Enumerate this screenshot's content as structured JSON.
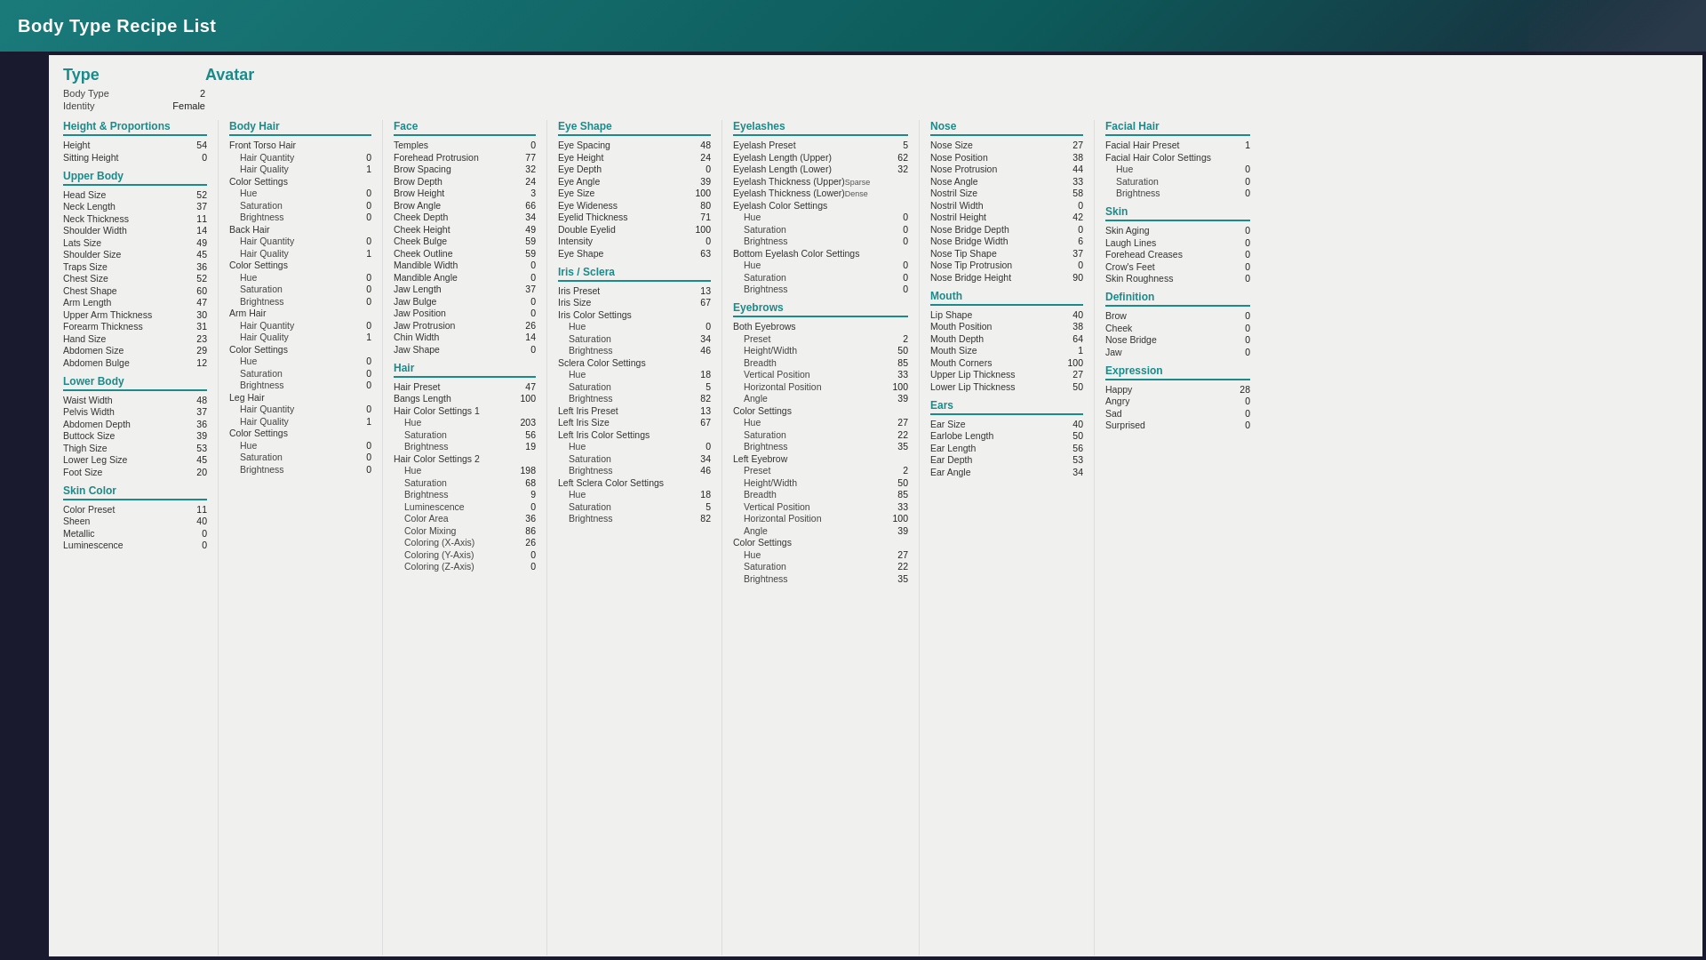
{
  "title": "Body Type Recipe List",
  "type": {
    "header": "Type",
    "rows": [
      {
        "name": "Body Type",
        "value": "2"
      },
      {
        "name": "Identity",
        "value": "Female"
      }
    ]
  },
  "avatar": {
    "header": "Avatar",
    "heightProportions": {
      "header": "Height & Proportions",
      "rows": [
        {
          "name": "Height",
          "value": "54"
        },
        {
          "name": "Sitting Height",
          "value": "0"
        }
      ]
    },
    "upperBody": {
      "header": "Upper Body",
      "rows": [
        {
          "name": "Head Size",
          "value": "52"
        },
        {
          "name": "Neck Length",
          "value": "37"
        },
        {
          "name": "Neck Thickness",
          "value": "11"
        },
        {
          "name": "Shoulder Width",
          "value": "14"
        },
        {
          "name": "Lats Size",
          "value": "49"
        },
        {
          "name": "Shoulder Size",
          "value": "45"
        },
        {
          "name": "Traps Size",
          "value": "36"
        },
        {
          "name": "Chest Size",
          "value": "52"
        },
        {
          "name": "Chest Shape",
          "value": "60"
        },
        {
          "name": "Arm Length",
          "value": "47"
        },
        {
          "name": "Upper Arm Thickness",
          "value": "30"
        },
        {
          "name": "Forearm Thickness",
          "value": "31"
        },
        {
          "name": "Hand Size",
          "value": "23"
        },
        {
          "name": "Abdomen Size",
          "value": "29"
        },
        {
          "name": "Abdomen Bulge",
          "value": "12"
        }
      ]
    },
    "lowerBody": {
      "header": "Lower Body",
      "rows": [
        {
          "name": "Waist Width",
          "value": "48"
        },
        {
          "name": "Pelvis Width",
          "value": "37"
        },
        {
          "name": "Abdomen Depth",
          "value": "36"
        },
        {
          "name": "Buttock Size",
          "value": "39"
        },
        {
          "name": "Thigh Size",
          "value": "53"
        },
        {
          "name": "Lower Leg Size",
          "value": "45"
        },
        {
          "name": "Foot Size",
          "value": "20"
        }
      ]
    },
    "skinColor": {
      "header": "Skin Color",
      "rows": [
        {
          "name": "Color Preset",
          "value": "11"
        },
        {
          "name": "Sheen",
          "value": "40"
        },
        {
          "name": "Metallic",
          "value": "0"
        },
        {
          "name": "Luminescence",
          "value": "0"
        }
      ]
    }
  },
  "bodyHair": {
    "header": "Body Hair",
    "frontTorso": {
      "label": "Front Torso Hair",
      "rows": [
        {
          "name": "Hair Quantity",
          "value": "0"
        },
        {
          "name": "Hair Quality",
          "value": "1"
        }
      ],
      "colorSettings": {
        "label": "Color Settings",
        "rows": [
          {
            "name": "Hue",
            "value": "0"
          },
          {
            "name": "Saturation",
            "value": "0"
          },
          {
            "name": "Brightness",
            "value": "0"
          }
        ]
      }
    },
    "backHair": {
      "label": "Back Hair",
      "rows": [
        {
          "name": "Hair Quantity",
          "value": "0"
        },
        {
          "name": "Hair Quality",
          "value": "1"
        }
      ],
      "colorSettings": {
        "label": "Color Settings",
        "rows": [
          {
            "name": "Hue",
            "value": "0"
          },
          {
            "name": "Saturation",
            "value": "0"
          },
          {
            "name": "Brightness",
            "value": "0"
          }
        ]
      }
    },
    "armHair": {
      "label": "Arm Hair",
      "rows": [
        {
          "name": "Hair Quantity",
          "value": "0"
        },
        {
          "name": "Hair Quality",
          "value": "1"
        }
      ],
      "colorSettings": {
        "label": "Color Settings",
        "rows": [
          {
            "name": "Hue",
            "value": "0"
          },
          {
            "name": "Saturation",
            "value": "0"
          },
          {
            "name": "Brightness",
            "value": "0"
          }
        ]
      }
    },
    "legHair": {
      "label": "Leg Hair",
      "rows": [
        {
          "name": "Hair Quantity",
          "value": "0"
        },
        {
          "name": "Hair Quality",
          "value": "1"
        }
      ],
      "colorSettings": {
        "label": "Color Settings",
        "rows": [
          {
            "name": "Hue",
            "value": "0"
          },
          {
            "name": "Saturation",
            "value": "0"
          },
          {
            "name": "Brightness",
            "value": "0"
          }
        ]
      }
    }
  },
  "face": {
    "header": "Face",
    "rows": [
      {
        "name": "Temples",
        "value": "0"
      },
      {
        "name": "Forehead Protrusion",
        "value": "77"
      },
      {
        "name": "Brow Spacing",
        "value": "32"
      },
      {
        "name": "Brow Depth",
        "value": "24"
      },
      {
        "name": "Brow Height",
        "value": "3"
      },
      {
        "name": "Brow Angle",
        "value": "66"
      },
      {
        "name": "Cheek Depth",
        "value": "34"
      },
      {
        "name": "Cheek Height",
        "value": "49"
      },
      {
        "name": "Cheek Bulge",
        "value": "59"
      },
      {
        "name": "Cheek Outline",
        "value": "59"
      },
      {
        "name": "Mandible Width",
        "value": "0"
      },
      {
        "name": "Mandible Angle",
        "value": "0"
      },
      {
        "name": "Jaw Length",
        "value": "37"
      },
      {
        "name": "Jaw Bulge",
        "value": "0"
      },
      {
        "name": "Jaw Position",
        "value": "0"
      },
      {
        "name": "Jaw Protrusion",
        "value": "26"
      },
      {
        "name": "Chin Width",
        "value": "14"
      },
      {
        "name": "Jaw Shape",
        "value": "0"
      }
    ]
  },
  "hair": {
    "header": "Hair",
    "rows": [
      {
        "name": "Hair Preset",
        "value": "47"
      },
      {
        "name": "Bangs Length",
        "value": "100"
      }
    ],
    "colorSettings1": {
      "label": "Hair Color Settings 1",
      "rows": [
        {
          "name": "Hue",
          "value": "203"
        },
        {
          "name": "Saturation",
          "value": "56"
        },
        {
          "name": "Brightness",
          "value": "19"
        }
      ]
    },
    "colorSettings2": {
      "label": "Hair Color Settings 2",
      "rows": [
        {
          "name": "Hue",
          "value": "198"
        },
        {
          "name": "Saturation",
          "value": "68"
        },
        {
          "name": "Brightness",
          "value": "9"
        },
        {
          "name": "Luminescence",
          "value": "0"
        },
        {
          "name": "Color Area",
          "value": "36"
        },
        {
          "name": "Color Mixing",
          "value": "86"
        },
        {
          "name": "Coloring (X-Axis)",
          "value": "26"
        },
        {
          "name": "Coloring (Y-Axis)",
          "value": "0"
        },
        {
          "name": "Coloring (Z-Axis)",
          "value": "0"
        }
      ]
    }
  },
  "eyeShape": {
    "header": "Eye Shape",
    "rows": [
      {
        "name": "Eye Spacing",
        "value": "48"
      },
      {
        "name": "Eye Height",
        "value": "24"
      },
      {
        "name": "Eye Depth",
        "value": "0"
      },
      {
        "name": "Eye Angle",
        "value": "39"
      },
      {
        "name": "Eye Size",
        "value": "100"
      },
      {
        "name": "Eye Wideness",
        "value": "80"
      },
      {
        "name": "Eyelid Thickness",
        "value": "71"
      },
      {
        "name": "Double Eyelid",
        "value": "100"
      },
      {
        "name": "Intensity",
        "value": "0"
      },
      {
        "name": "Eye Shape",
        "value": "63"
      }
    ],
    "irisHeader": "Iris / Sclera",
    "iris": [
      {
        "name": "Iris Preset",
        "value": "13"
      },
      {
        "name": "Iris Size",
        "value": "67"
      }
    ],
    "irisColorSettings": {
      "label": "Iris Color Settings",
      "rows": [
        {
          "name": "Hue",
          "value": "0"
        },
        {
          "name": "Saturation",
          "value": "34"
        },
        {
          "name": "Brightness",
          "value": "46"
        }
      ]
    },
    "scleraColorSettings": {
      "label": "Sclera Color Settings",
      "rows": [
        {
          "name": "Hue",
          "value": "18"
        },
        {
          "name": "Saturation",
          "value": "5"
        },
        {
          "name": "Brightness",
          "value": "82"
        }
      ]
    },
    "leftIrisPreset": {
      "name": "Left Iris Preset",
      "value": "13"
    },
    "leftIrisSize": {
      "name": "Left Iris Size",
      "value": "67"
    },
    "leftIrisColorSettings": {
      "label": "Left Iris Color Settings",
      "rows": [
        {
          "name": "Hue",
          "value": "0"
        },
        {
          "name": "Saturation",
          "value": "34"
        },
        {
          "name": "Brightness",
          "value": "46"
        }
      ]
    },
    "leftScleraColorSettings": {
      "label": "Left Sclera Color Settings",
      "rows": [
        {
          "name": "Hue",
          "value": "18"
        },
        {
          "name": "Saturation",
          "value": "5"
        },
        {
          "name": "Brightness",
          "value": "82"
        }
      ]
    }
  },
  "eyelashes": {
    "header": "Eyelashes",
    "rows": [
      {
        "name": "Eyelash Preset",
        "value": "5"
      },
      {
        "name": "Eyelash Length (Upper)",
        "value": "62"
      },
      {
        "name": "Eyelash Length (Lower)",
        "value": "32"
      },
      {
        "name": "Eyelash Thickness (Upper)",
        "value": "Sparse"
      },
      {
        "name": "Eyelash Thickness (Lower)",
        "value": "Dense"
      }
    ],
    "eyelashColorSettings": {
      "label": "Eyelash Color Settings",
      "rows": [
        {
          "name": "Hue",
          "value": "0"
        },
        {
          "name": "Saturation",
          "value": "0"
        },
        {
          "name": "Brightness",
          "value": "0"
        }
      ]
    },
    "bottomEyelashColorSettings": {
      "label": "Bottom Eyelash Color Settings",
      "rows": [
        {
          "name": "Hue",
          "value": "0"
        },
        {
          "name": "Saturation",
          "value": "0"
        },
        {
          "name": "Brightness",
          "value": "0"
        }
      ]
    }
  },
  "eyebrows": {
    "header": "Eyebrows",
    "bothEyebrows": "Both Eyebrows",
    "rows": [
      {
        "name": "Preset",
        "value": "2"
      },
      {
        "name": "Height/Width",
        "value": "50"
      },
      {
        "name": "Breadth",
        "value": "85"
      },
      {
        "name": "Vertical Position",
        "value": "33"
      },
      {
        "name": "Horizontal Position",
        "value": "100"
      },
      {
        "name": "Angle",
        "value": "39"
      }
    ],
    "colorSettings": {
      "label": "Color Settings",
      "rows": [
        {
          "name": "Hue",
          "value": "27"
        },
        {
          "name": "Saturation",
          "value": "22"
        },
        {
          "name": "Brightness",
          "value": "35"
        }
      ]
    },
    "leftEyebrow": "Left Eyebrow",
    "leftRows": [
      {
        "name": "Preset",
        "value": "2"
      },
      {
        "name": "Height/Width",
        "value": "50"
      },
      {
        "name": "Breadth",
        "value": "85"
      },
      {
        "name": "Vertical Position",
        "value": "33"
      },
      {
        "name": "Horizontal Position",
        "value": "100"
      },
      {
        "name": "Angle",
        "value": "39"
      }
    ],
    "leftColorSettings": {
      "label": "Color Settings",
      "rows": [
        {
          "name": "Hue",
          "value": "27"
        },
        {
          "name": "Saturation",
          "value": "22"
        },
        {
          "name": "Brightness",
          "value": "35"
        }
      ]
    }
  },
  "nose": {
    "header": "Nose",
    "rows": [
      {
        "name": "Nose Size",
        "value": "27"
      },
      {
        "name": "Nose Position",
        "value": "38"
      },
      {
        "name": "Nose Protrusion",
        "value": "44"
      },
      {
        "name": "Nose Angle",
        "value": "33"
      },
      {
        "name": "Nostril Size",
        "value": "58"
      },
      {
        "name": "Nostril Width",
        "value": "0"
      },
      {
        "name": "Nostril Height",
        "value": "42"
      },
      {
        "name": "Nose Bridge Depth",
        "value": "0"
      },
      {
        "name": "Nose Bridge Width",
        "value": "6"
      },
      {
        "name": "Nose Tip Shape",
        "value": "37"
      },
      {
        "name": "Nose Tip Protrusion",
        "value": "0"
      },
      {
        "name": "Nose Bridge Height",
        "value": "90"
      }
    ]
  },
  "mouth": {
    "header": "Mouth",
    "rows": [
      {
        "name": "Lip Shape",
        "value": "40"
      },
      {
        "name": "Mouth Position",
        "value": "38"
      },
      {
        "name": "Mouth Depth",
        "value": "64"
      },
      {
        "name": "Mouth Size",
        "value": "1"
      },
      {
        "name": "Mouth Corners",
        "value": "100"
      },
      {
        "name": "Upper Lip Thickness",
        "value": "27"
      },
      {
        "name": "Lower Lip Thickness",
        "value": "50"
      }
    ]
  },
  "ears": {
    "header": "Ears",
    "rows": [
      {
        "name": "Ear Size",
        "value": "40"
      },
      {
        "name": "Earlobe Length",
        "value": "50"
      },
      {
        "name": "Ear Length",
        "value": "56"
      },
      {
        "name": "Ear Depth",
        "value": "53"
      },
      {
        "name": "Ear Angle",
        "value": "34"
      }
    ]
  },
  "facialHair": {
    "header": "Facial Hair",
    "rows": [
      {
        "name": "Facial Hair Preset",
        "value": "1"
      },
      {
        "name": "Facial Hair Color Settings",
        "value": ""
      }
    ],
    "colorSettings": {
      "rows": [
        {
          "name": "Hue",
          "value": "0"
        },
        {
          "name": "Saturation",
          "value": "0"
        },
        {
          "name": "Brightness",
          "value": "0"
        }
      ]
    }
  },
  "skin": {
    "header": "Skin",
    "rows": [
      {
        "name": "Skin Aging",
        "value": "0"
      },
      {
        "name": "Laugh Lines",
        "value": "0"
      },
      {
        "name": "Forehead Creases",
        "value": "0"
      },
      {
        "name": "Crow's Feet",
        "value": "0"
      },
      {
        "name": "Skin Roughness",
        "value": "0"
      }
    ]
  },
  "definition": {
    "header": "Definition",
    "rows": [
      {
        "name": "Brow",
        "value": "0"
      },
      {
        "name": "Cheek",
        "value": "0"
      },
      {
        "name": "Nose Bridge",
        "value": "0"
      },
      {
        "name": "Jaw",
        "value": "0"
      }
    ]
  },
  "expression": {
    "header": "Expression",
    "rows": [
      {
        "name": "Happy",
        "value": "28"
      },
      {
        "name": "Angry",
        "value": "0"
      },
      {
        "name": "Sad",
        "value": "0"
      },
      {
        "name": "Surprised",
        "value": "0"
      }
    ]
  },
  "colors": {
    "accent": "#1a8a8a",
    "bg": "#f0f0ee",
    "topbar": "#0d5a5a"
  }
}
